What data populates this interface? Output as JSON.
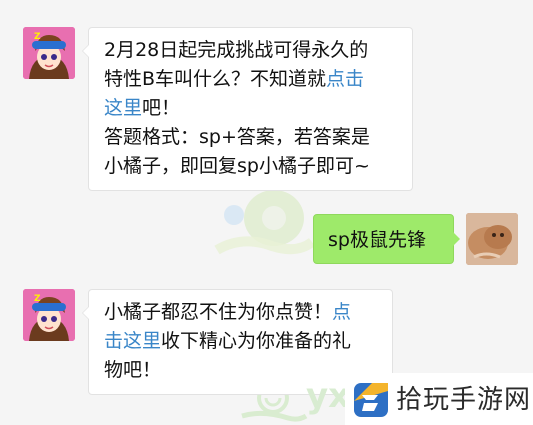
{
  "messages": [
    {
      "sender": "bot",
      "text_line1": "2月28日起完成挑战可得永久的",
      "text_line2_pre": "特性B车叫什么？不知道就",
      "text_line2_link": "点击",
      "text_line3_link": "这里",
      "text_line3_post": "吧！",
      "text_line4": "答题格式：sp+答案，若答案是",
      "text_line5": "小橘子，即回复sp小橘子即可~"
    },
    {
      "sender": "user",
      "text": "sp极鼠先锋"
    },
    {
      "sender": "bot",
      "text_line1_pre": "小橘子都忍不住为你点赞！",
      "text_line1_link": "点",
      "text_line2_link": "击这里",
      "text_line2_post": "收下精心为你准备的礼",
      "text_line3": "物吧！"
    }
  ],
  "watermark": {
    "site_name": "拾玩手游网",
    "partial_text": "yx"
  },
  "colors": {
    "background": "#f5f5f5",
    "bubble_bot": "#ffffff",
    "bubble_user": "#9eea6a",
    "link": "#3a86c8"
  },
  "icons": {
    "bot_avatar": "bot-avatar-icon",
    "user_avatar": "user-avatar-icon",
    "watermark_logo": "site-logo-icon"
  }
}
